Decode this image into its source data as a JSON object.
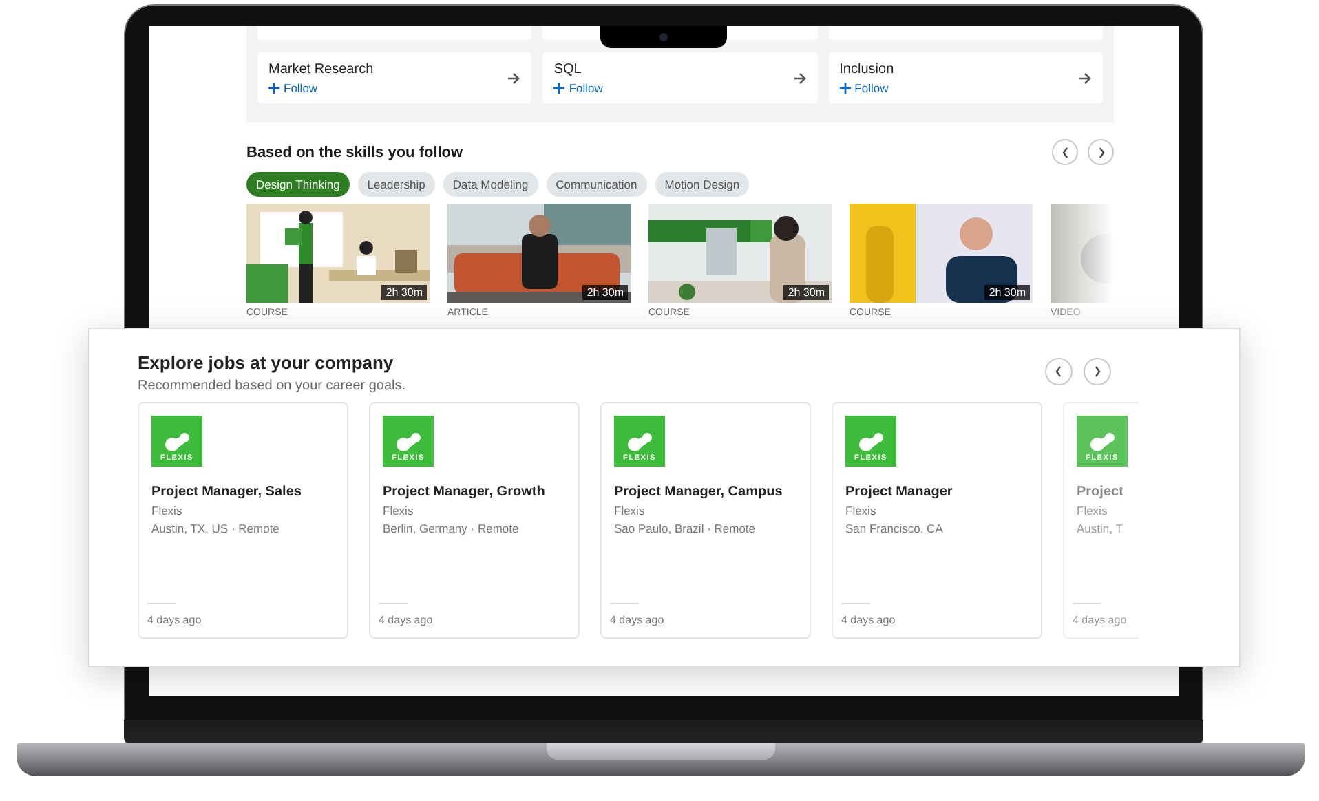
{
  "topics_row": [
    {
      "name": "Market Research",
      "action": "Follow"
    },
    {
      "name": "SQL",
      "action": "Follow"
    },
    {
      "name": "Inclusion",
      "action": "Follow"
    }
  ],
  "skills_section": {
    "title": "Based on the skills you follow",
    "chips": [
      {
        "label": "Design Thinking",
        "selected": true
      },
      {
        "label": "Leadership",
        "selected": false
      },
      {
        "label": "Data Modeling",
        "selected": false
      },
      {
        "label": "Communication",
        "selected": false
      },
      {
        "label": "Motion Design",
        "selected": false
      }
    ],
    "items": [
      {
        "duration": "2h 30m",
        "type": "COURSE"
      },
      {
        "duration": "2h 30m",
        "type": "ARTICLE"
      },
      {
        "duration": "2h 30m",
        "type": "COURSE"
      },
      {
        "duration": "2h 30m",
        "type": "COURSE"
      },
      {
        "type": "VIDEO"
      }
    ]
  },
  "jobs_panel": {
    "title": "Explore jobs at your company",
    "subtitle": "Recommended based on your career goals.",
    "jobs": [
      {
        "logo_text": "FLEXIS",
        "title": "Project Manager, Sales",
        "company": "Flexis",
        "location": "Austin, TX, US · Remote",
        "posted": "4 days ago",
        "faded": false
      },
      {
        "logo_text": "FLEXIS",
        "title": "Project Manager, Growth",
        "company": "Flexis",
        "location": "Berlin, Germany · Remote",
        "posted": "4 days ago",
        "faded": false
      },
      {
        "logo_text": "FLEXIS",
        "title": "Project Manager, Campus",
        "company": "Flexis",
        "location": "Sao Paulo, Brazil · Remote",
        "posted": "4 days ago",
        "faded": false
      },
      {
        "logo_text": "FLEXIS",
        "title": "Project Manager",
        "company": "Flexis",
        "location": "San Francisco, CA",
        "posted": "4 days ago",
        "faded": false
      },
      {
        "logo_text": "FLEXIS",
        "title": "Project",
        "company": "Flexis",
        "location": "Austin, T",
        "posted": "4 days ago",
        "faded": true
      }
    ]
  }
}
